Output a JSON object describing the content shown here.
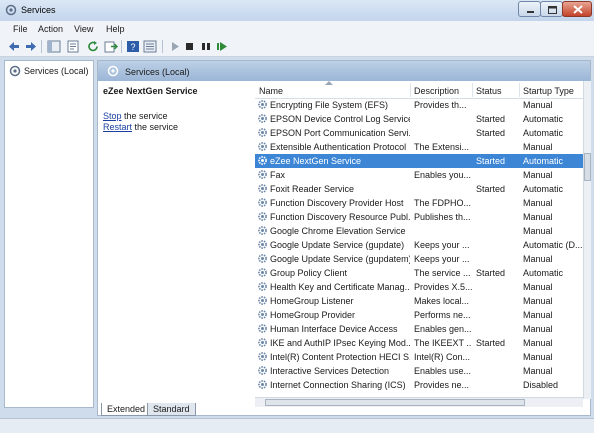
{
  "window": {
    "title": "Services"
  },
  "menu": [
    "File",
    "Action",
    "View",
    "Help"
  ],
  "tree": {
    "item": "Services (Local)"
  },
  "pane": {
    "header": "Services (Local)",
    "selected_service": "eZee NextGen Service",
    "stop_link": "Stop",
    "stop_rest": " the service",
    "restart_link": "Restart",
    "restart_rest": " the service"
  },
  "columns": [
    "Name",
    "Description",
    "Status",
    "Startup Type"
  ],
  "services": [
    {
      "name": "Encrypting File System (EFS)",
      "description": "Provides th...",
      "status": "",
      "startup": "Manual"
    },
    {
      "name": "EPSON Device Control Log Service",
      "description": "",
      "status": "Started",
      "startup": "Automatic"
    },
    {
      "name": "EPSON Port Communication Servi...",
      "description": "",
      "status": "Started",
      "startup": "Automatic"
    },
    {
      "name": "Extensible Authentication Protocol",
      "description": "The Extensi...",
      "status": "",
      "startup": "Manual"
    },
    {
      "name": "eZee NextGen Service",
      "description": "",
      "status": "Started",
      "startup": "Automatic",
      "selected": true
    },
    {
      "name": "Fax",
      "description": "Enables you...",
      "status": "",
      "startup": "Manual"
    },
    {
      "name": "Foxit Reader Service",
      "description": "",
      "status": "Started",
      "startup": "Automatic"
    },
    {
      "name": "Function Discovery Provider Host",
      "description": "The FDPHO...",
      "status": "",
      "startup": "Manual"
    },
    {
      "name": "Function Discovery Resource Publ...",
      "description": "Publishes th...",
      "status": "",
      "startup": "Manual"
    },
    {
      "name": "Google Chrome Elevation Service",
      "description": "",
      "status": "",
      "startup": "Manual"
    },
    {
      "name": "Google Update Service (gupdate)",
      "description": "Keeps your ...",
      "status": "",
      "startup": "Automatic (D..."
    },
    {
      "name": "Google Update Service (gupdatem)",
      "description": "Keeps your ...",
      "status": "",
      "startup": "Manual"
    },
    {
      "name": "Group Policy Client",
      "description": "The service ...",
      "status": "Started",
      "startup": "Automatic"
    },
    {
      "name": "Health Key and Certificate Manag...",
      "description": "Provides X.5...",
      "status": "",
      "startup": "Manual"
    },
    {
      "name": "HomeGroup Listener",
      "description": "Makes local...",
      "status": "",
      "startup": "Manual"
    },
    {
      "name": "HomeGroup Provider",
      "description": "Performs ne...",
      "status": "",
      "startup": "Manual"
    },
    {
      "name": "Human Interface Device Access",
      "description": "Enables gen...",
      "status": "",
      "startup": "Manual"
    },
    {
      "name": "IKE and AuthIP IPsec Keying Mod...",
      "description": "The IKEEXT ...",
      "status": "Started",
      "startup": "Manual"
    },
    {
      "name": "Intel(R) Content Protection HECI S...",
      "description": "Intel(R) Con...",
      "status": "",
      "startup": "Manual"
    },
    {
      "name": "Interactive Services Detection",
      "description": "Enables use...",
      "status": "",
      "startup": "Manual"
    },
    {
      "name": "Internet Connection Sharing (ICS)",
      "description": "Provides ne...",
      "status": "",
      "startup": "Disabled"
    }
  ],
  "tabs": [
    "Extended",
    "Standard"
  ],
  "icons": [
    "services-icon",
    "back-arrow-icon",
    "forward-arrow-icon",
    "console-tree-icon",
    "properties-icon",
    "refresh-icon",
    "export-icon",
    "help-icon",
    "view-icon",
    "play-icon",
    "stop-icon",
    "pause-icon",
    "restart-icon",
    "gear-icon"
  ],
  "colors": {
    "selection": "#3d86d6",
    "link": "#1a3fa0",
    "pane_header": "#9cb6d6"
  }
}
